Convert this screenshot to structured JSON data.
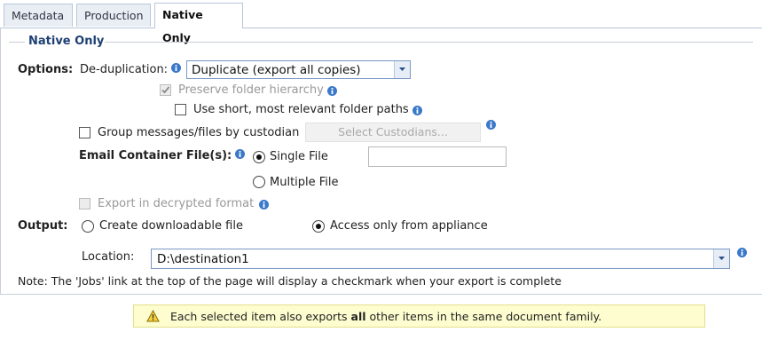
{
  "tabs": [
    {
      "label": "Metadata"
    },
    {
      "label": "Production"
    },
    {
      "label": "Native Only",
      "active": true
    }
  ],
  "section_title": "Native Only",
  "options": {
    "label": "Options:",
    "dedup_label": "De-duplication:",
    "dedup_value": "Duplicate (export all copies)",
    "preserve_hierarchy": {
      "label": "Preserve folder hierarchy",
      "checked": true,
      "disabled": true
    },
    "short_paths": {
      "label": "Use short, most relevant folder paths",
      "checked": false
    },
    "group_by_custodian": {
      "label": "Group messages/files by custodian",
      "checked": false
    },
    "select_custodians_button": "Select Custodians...",
    "email_container_label": "Email Container File(s):",
    "single_file": {
      "label": "Single File",
      "selected": true
    },
    "multiple_file": {
      "label": "Multiple File",
      "selected": false
    },
    "export_decrypted": {
      "label": "Export in decrypted format",
      "checked": false,
      "disabled": true
    }
  },
  "output": {
    "label": "Output:",
    "create_downloadable": {
      "label": "Create downloadable file",
      "selected": false
    },
    "access_from_appliance": {
      "label": "Access only from appliance",
      "selected": true
    }
  },
  "location": {
    "label": "Location:",
    "value": "D:\\destination1"
  },
  "note": "Note: The 'Jobs' link at the top of the page will display a checkmark when your export is complete",
  "warning": {
    "prefix": "Each selected item also exports ",
    "emphasis": "all",
    "suffix": " other items in the same document family."
  },
  "colors": {
    "accent": "#1d3f73",
    "info_icon": "#3a78c9",
    "warning_bg": "#fdfdcf"
  }
}
